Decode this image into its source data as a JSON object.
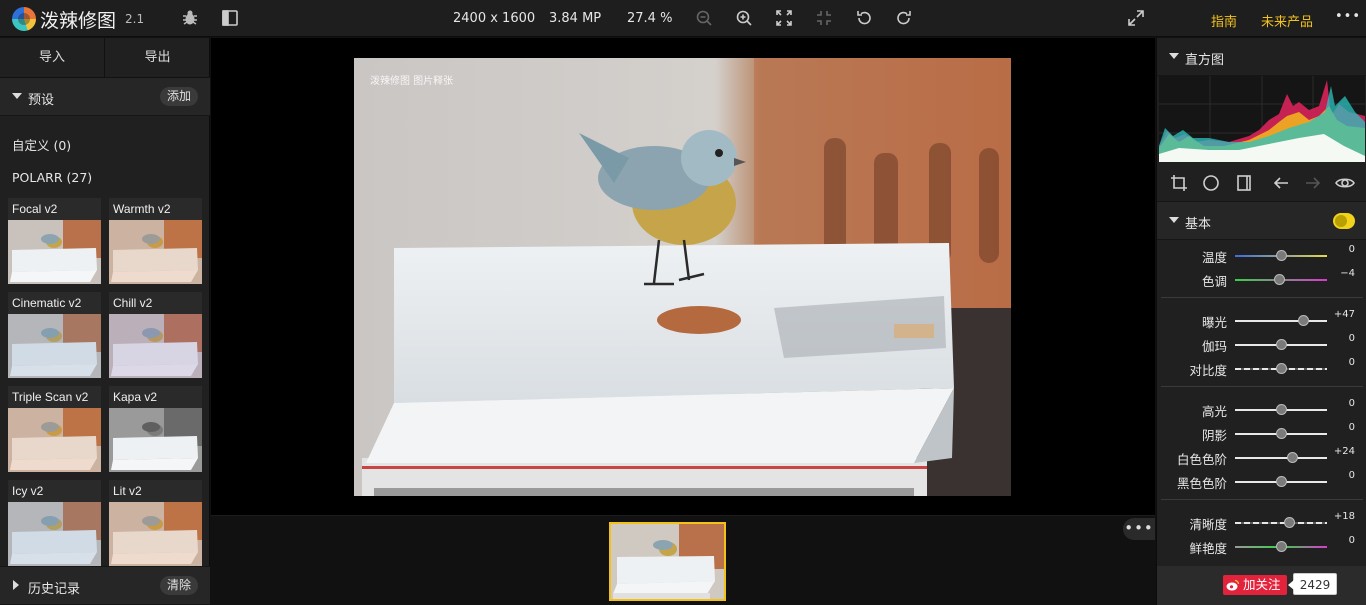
{
  "app": {
    "name": "泼辣修图",
    "version": "2.1"
  },
  "toolbar": {
    "dimensions": "2400 x 1600",
    "megapixels": "3.84 MP",
    "zoom": "27.4 %",
    "guide_label": "指南",
    "future_label": "未来产品",
    "more_label": "•••"
  },
  "left_panel": {
    "import_label": "导入",
    "export_label": "导出",
    "presets_title": "预设",
    "add_label": "添加",
    "custom_group": "自定义 (0)",
    "polarr_group": "POLARR (27)",
    "presets": [
      {
        "label": "Focal v2",
        "filter": "none"
      },
      {
        "label": "Warmth v2",
        "filter": "warm"
      },
      {
        "label": "Cinematic v2",
        "filter": "cool"
      },
      {
        "label": "Chill v2",
        "filter": "purple"
      },
      {
        "label": "Triple Scan v2",
        "filter": "warm"
      },
      {
        "label": "Kapa v2",
        "filter": "mono"
      },
      {
        "label": "Icy v2",
        "filter": "cool"
      },
      {
        "label": "Lit v2",
        "filter": "warm"
      }
    ],
    "history_title": "历史记录",
    "clear_label": "清除"
  },
  "canvas": {
    "watermark": "泼辣修图 图片释张"
  },
  "filmstrip": {
    "more_label": "•••"
  },
  "right_panel": {
    "histogram_title": "直方图",
    "basic_title": "基本",
    "basic_enabled": true,
    "sliders": [
      {
        "label": "温度",
        "value": "0",
        "level": 0,
        "track": "temp"
      },
      {
        "label": "色调",
        "value": "−4",
        "level": -4,
        "track": "tint"
      },
      {
        "label": "曝光",
        "value": "+47",
        "level": 47,
        "track": "plain"
      },
      {
        "label": "伽玛",
        "value": "0",
        "level": 0,
        "track": "plain"
      },
      {
        "label": "对比度",
        "value": "0",
        "level": 0,
        "track": "dash"
      },
      {
        "label": "高光",
        "value": "0",
        "level": 0,
        "track": "plain"
      },
      {
        "label": "阴影",
        "value": "0",
        "level": 0,
        "track": "plain"
      },
      {
        "label": "白色色阶",
        "value": "+24",
        "level": 24,
        "track": "plain"
      },
      {
        "label": "黑色色阶",
        "value": "0",
        "level": 0,
        "track": "plain"
      },
      {
        "label": "清晰度",
        "value": "+18",
        "level": 18,
        "track": "dash"
      },
      {
        "label": "鲜艳度",
        "value": "0",
        "level": 0,
        "track": "vivid"
      }
    ],
    "follow_label": "加关注",
    "follow_count": "2429"
  }
}
